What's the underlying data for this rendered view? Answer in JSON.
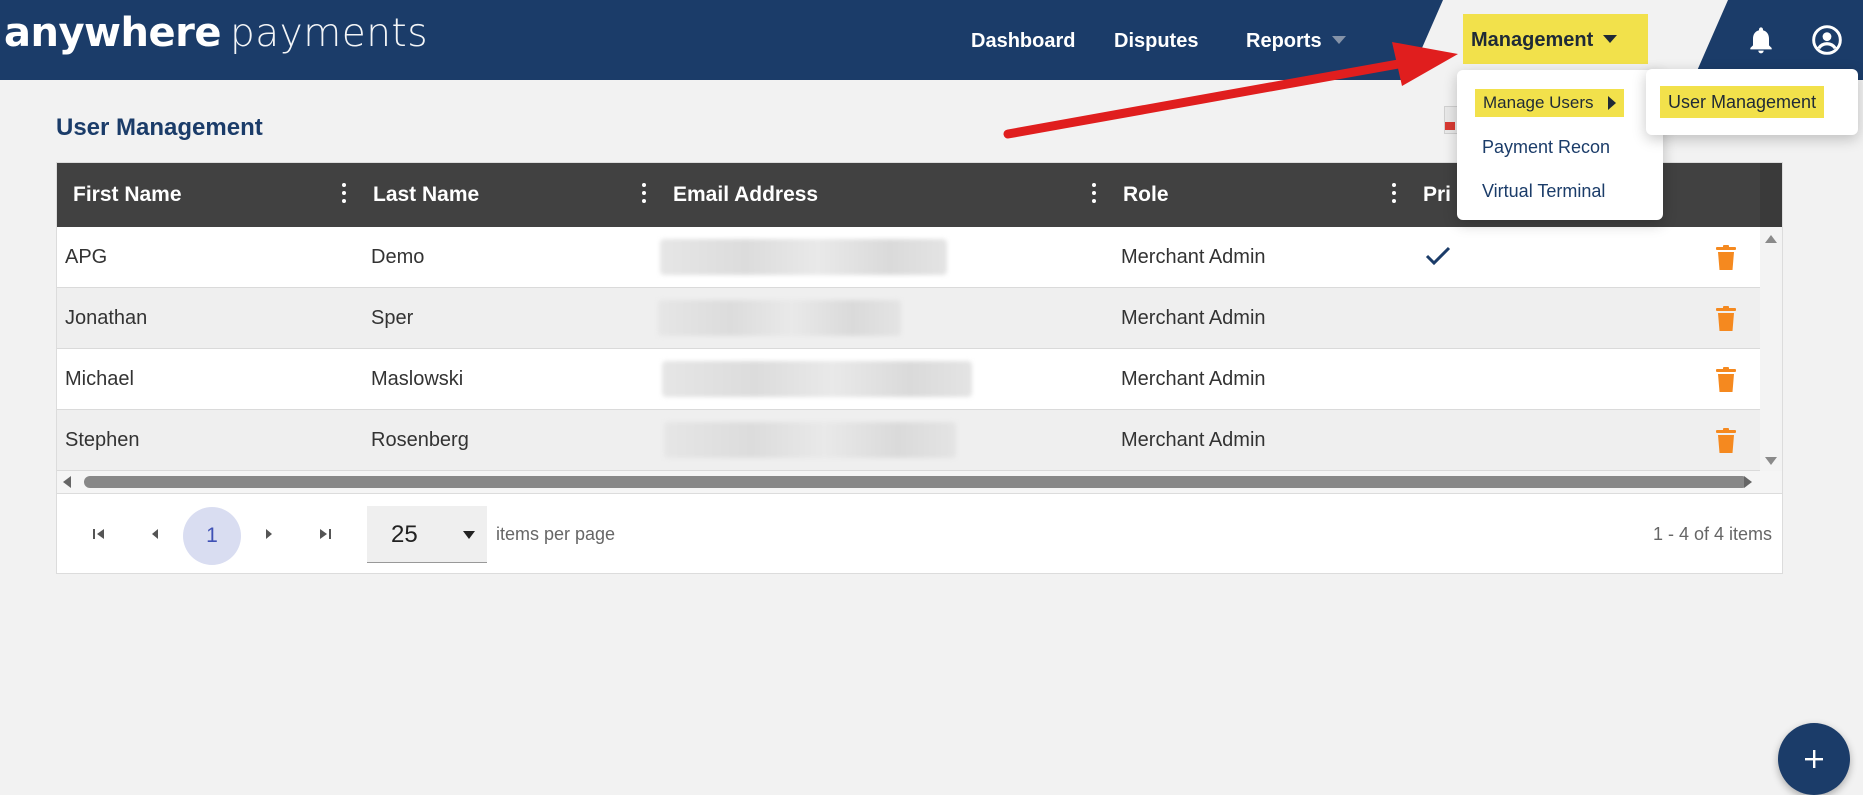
{
  "brand": {
    "bold": "anywhere",
    "light": "payments"
  },
  "nav": {
    "dashboard": "Dashboard",
    "disputes": "Disputes",
    "reports": "Reports",
    "management": "Management"
  },
  "page": {
    "title": "User Management"
  },
  "table": {
    "columns": [
      "First Name",
      "Last Name",
      "Email Address",
      "Role",
      "Pri"
    ],
    "rows": [
      {
        "first": "APG",
        "last": "Demo",
        "role": "Merchant Admin",
        "primary": true
      },
      {
        "first": "Jonathan",
        "last": "Sper",
        "role": "Merchant Admin",
        "primary": false
      },
      {
        "first": "Michael",
        "last": "Maslowski",
        "role": "Merchant Admin",
        "primary": false
      },
      {
        "first": "Stephen",
        "last": "Rosenberg",
        "role": "Merchant Admin",
        "primary": false
      }
    ]
  },
  "pager": {
    "current_page": "1",
    "page_size": "25",
    "items_per_page_label": "items per page",
    "info": "1 - 4 of 4 items"
  },
  "management_menu": {
    "items": [
      "Manage Users",
      "Payment Recon",
      "Virtual Terminal"
    ]
  },
  "submenu": {
    "items": [
      "User Management"
    ]
  },
  "colors": {
    "navy": "#1b3c69",
    "highlight": "#f2e14b",
    "header_gray": "#414141",
    "trash_orange": "#f5891f",
    "annotation_red": "#e01e1e"
  },
  "icons": {
    "notifications": "bell-icon",
    "account": "user-circle-icon",
    "delete": "trash-icon",
    "primary": "checkmark-icon",
    "add": "plus-icon"
  }
}
